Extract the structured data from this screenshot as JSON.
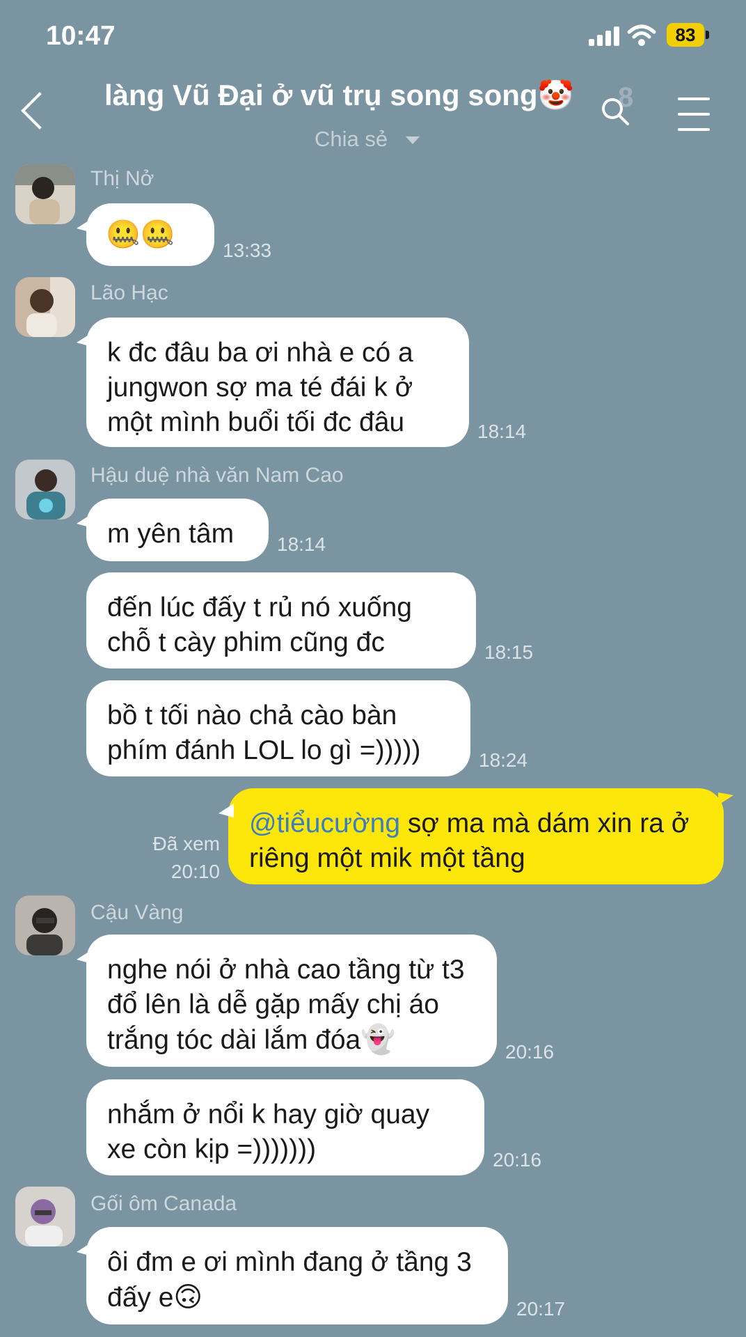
{
  "status_bar": {
    "time": "10:47",
    "battery": "83"
  },
  "header": {
    "title": "làng Vũ Đại ở vũ trụ song song",
    "title_emoji": "🤡",
    "member_count": "8",
    "subtitle": "Chia sẻ"
  },
  "messages": [
    {
      "sender": "Thị Nở",
      "text": "🤐🤐",
      "time": "13:33"
    },
    {
      "sender": "Lão Hạc",
      "text": "k đc đâu ba ơi nhà e có a jungwon sợ ma té đái k ở một mình buổi tối đc đâu",
      "time": "18:14"
    },
    {
      "sender": "Hậu duệ nhà văn Nam Cao",
      "text": "m yên tâm",
      "time": "18:14"
    },
    {
      "text": "đến lúc đấy t rủ nó xuống chỗ t cày phim cũng đc",
      "time": "18:15"
    },
    {
      "text": "bồ t tối nào chả cào bàn phím đánh LOL lo gì =)))))",
      "time": "18:24"
    },
    {
      "mention": "@tiểucường",
      "text": " sợ ma mà dám xin ra ở riêng một mik một tầng",
      "seen": "Đã xem",
      "time": "20:10"
    },
    {
      "sender": "Cậu Vàng",
      "text": "nghe nói ở nhà cao tầng từ t3 đổ lên là dễ gặp mấy chị áo trắng tóc dài lắm đóa",
      "emoji": "👻",
      "time": "20:16"
    },
    {
      "text": "nhắm ở nổi k hay giờ quay xe còn kịp =)))))))",
      "time": "20:16"
    },
    {
      "sender": "Gối ôm Canada",
      "text": "ôi đm e ơi mình đang ở tầng 3 đấy e",
      "emoji": "🙃",
      "time": "20:17"
    }
  ]
}
